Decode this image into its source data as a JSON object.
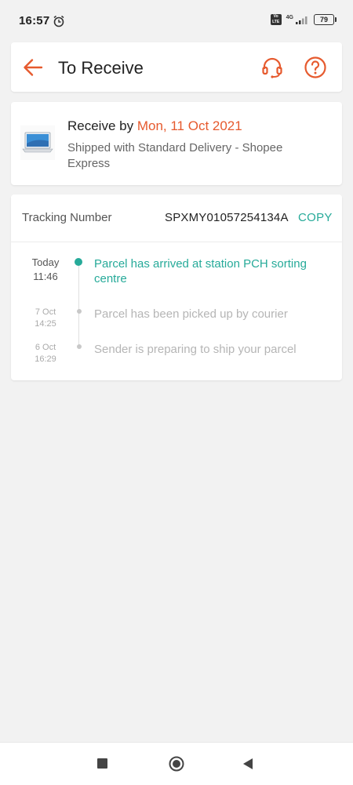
{
  "status_bar": {
    "time": "16:57",
    "network": "4G",
    "battery": "79"
  },
  "header": {
    "title": "To Receive"
  },
  "delivery": {
    "receive_by_label": "Receive by ",
    "receive_by_date": "Mon, 11 Oct 2021",
    "shipping_info": "Shipped with Standard Delivery - Shopee Express"
  },
  "tracking": {
    "label": "Tracking Number",
    "number": "SPXMY01057254134A",
    "copy_label": "COPY",
    "events": [
      {
        "day": "Today",
        "time": "11:46",
        "text": "Parcel has arrived at station PCH sorting centre"
      },
      {
        "day": "7 Oct",
        "time": "14:25",
        "text": "Parcel has been picked up by courier"
      },
      {
        "day": "6 Oct",
        "time": "16:29",
        "text": "Sender is preparing to ship your parcel"
      }
    ]
  },
  "colors": {
    "accent": "#e65a2e",
    "teal": "#26aa99",
    "background": "#f2f2f2"
  },
  "icons": {
    "back": "arrow-left-icon",
    "support": "headset-icon",
    "help": "question-circle-icon"
  }
}
